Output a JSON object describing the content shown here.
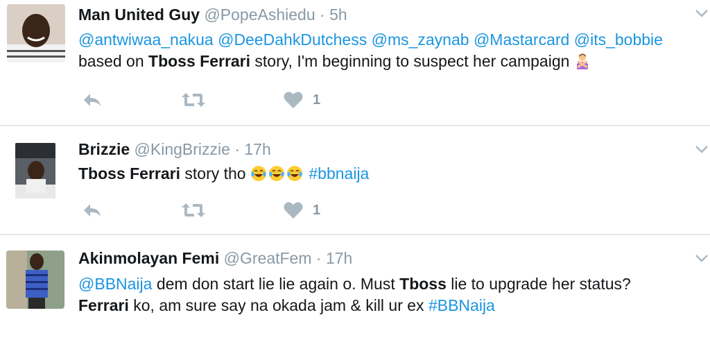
{
  "tweets": [
    {
      "name": "Man United Guy",
      "handle": "@PopeAshiedu",
      "dot": "·",
      "time": "5h",
      "line1": [
        {
          "t": "@antwiwaa_nakua",
          "cls": "link"
        },
        {
          "t": " ",
          "cls": ""
        },
        {
          "t": "@DeeDahkDutchess",
          "cls": "link"
        },
        {
          "t": " ",
          "cls": ""
        },
        {
          "t": "@ms_zaynab",
          "cls": "link"
        },
        {
          "t": " ",
          "cls": ""
        },
        {
          "t": "@Mastarcard",
          "cls": "link"
        },
        {
          "t": " ",
          "cls": ""
        },
        {
          "t": "@its_bobbie",
          "cls": "link"
        }
      ],
      "line2": [
        {
          "t": "based on ",
          "cls": ""
        },
        {
          "t": "Tboss Ferrari",
          "cls": "bold"
        },
        {
          "t": " story, I'm beginning to suspect her campaign ",
          "cls": ""
        },
        {
          "t": "person-gesturing-no-emoji",
          "cls": "emoji-no"
        }
      ],
      "likes": "1"
    },
    {
      "name": "Brizzie",
      "handle": "@KingBrizzie",
      "dot": "·",
      "time": "17h",
      "line1": [
        {
          "t": "Tboss Ferrari",
          "cls": "bold"
        },
        {
          "t": " story tho ",
          "cls": ""
        },
        {
          "t": "tears-of-joy-emoji",
          "cls": "emoji-joy"
        },
        {
          "t": "tears-of-joy-emoji",
          "cls": "emoji-joy"
        },
        {
          "t": "tears-of-joy-emoji",
          "cls": "emoji-joy"
        },
        {
          "t": " ",
          "cls": ""
        },
        {
          "t": "#bbnaija",
          "cls": "link"
        }
      ],
      "line2": [],
      "likes": "1"
    },
    {
      "name": "Akinmolayan Femi",
      "handle": "@GreatFem",
      "dot": "·",
      "time": "17h",
      "line1": [
        {
          "t": "@BBNaija",
          "cls": "link"
        },
        {
          "t": " dem don start lie lie again o. Must ",
          "cls": ""
        },
        {
          "t": "Tboss",
          "cls": "bold"
        },
        {
          "t": " lie to upgrade her status?",
          "cls": ""
        }
      ],
      "line2": [
        {
          "t": "Ferrari",
          "cls": "bold"
        },
        {
          "t": " ko, am sure say na okada jam & kill ur ex ",
          "cls": ""
        },
        {
          "t": "#BBNaija",
          "cls": "link"
        }
      ],
      "likes": ""
    }
  ],
  "icons": {
    "reply": "reply-icon",
    "retweet": "retweet-icon",
    "like": "heart-icon",
    "more": "chevron-down-icon"
  },
  "colors": {
    "link": "#1b95e0",
    "muted": "#8899a6",
    "icon": "#aab8c2",
    "divider": "#e1e8ed"
  }
}
